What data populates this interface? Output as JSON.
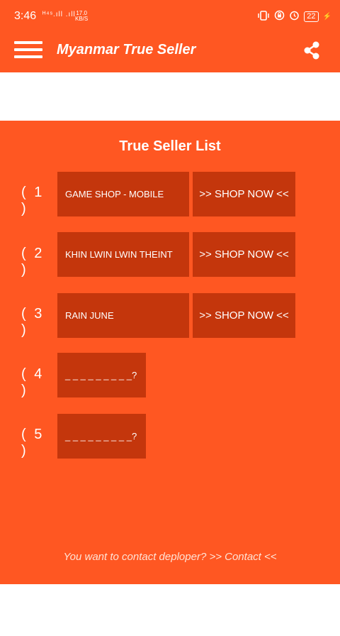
{
  "status_bar": {
    "time": "3:46",
    "network": "ᴴ⁴ˢ.ıll .ıll",
    "speed_value": "17.0",
    "speed_unit": "KB/S",
    "icons": [
      "vibrate-icon",
      "lock-rotation-icon",
      "alarm-icon"
    ],
    "battery": "22"
  },
  "app_bar": {
    "title": "Myanmar True Seller",
    "menu_icon": "hamburger-menu-icon",
    "share_icon": "share-icon"
  },
  "main": {
    "title": "True Seller List",
    "rows": [
      {
        "number": "( 1 )",
        "seller": "GAME SHOP - MOBILE",
        "button": ">> SHOP NOW <<"
      },
      {
        "number": "( 2 )",
        "seller": "KHIN LWIN LWIN THEINT",
        "button": ">> SHOP NOW <<"
      },
      {
        "number": "( 3 )",
        "seller": "RAIN JUNE",
        "button": ">> SHOP NOW <<"
      },
      {
        "number": "( 4 )",
        "seller": "_ _ _ _ _ _ _ _ _?"
      },
      {
        "number": "( 5 )",
        "seller": "_ _ _ _ _ _ _ _ _?"
      }
    ],
    "contact_text": "You want to contact deploper? >> Contact <<"
  },
  "colors": {
    "primary": "#ff5722",
    "box": "#c4360c",
    "background": "#ffffff"
  }
}
